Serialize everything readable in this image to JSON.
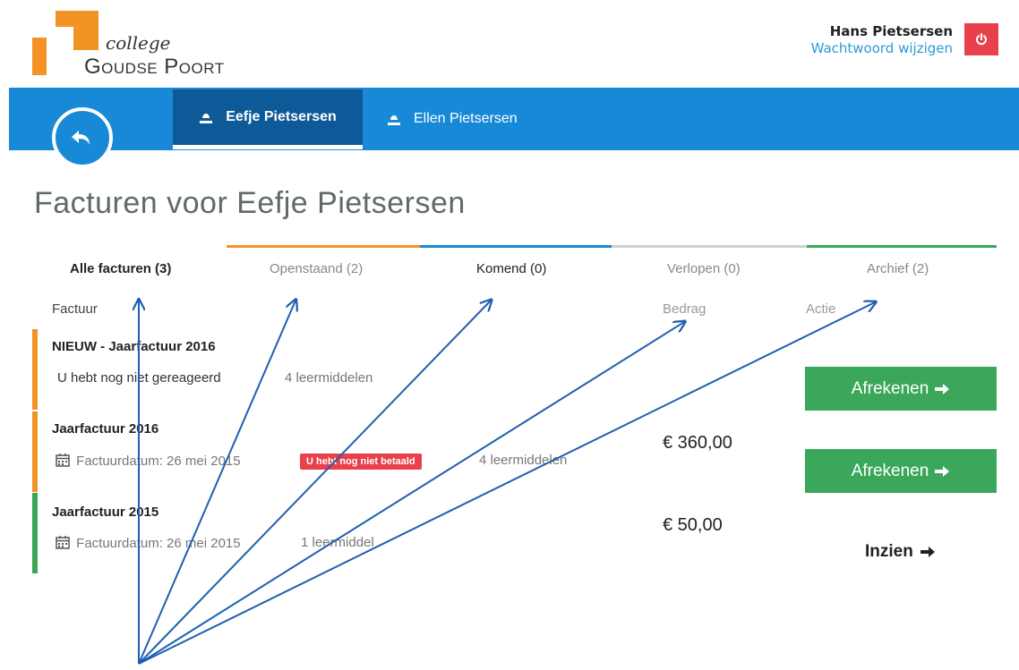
{
  "logo": {
    "line1": "college",
    "line2": "Goudse Poort"
  },
  "user": {
    "name": "Hans Pietsersen",
    "change_password": "Wachtwoord wijzigen"
  },
  "person_tabs": [
    {
      "label": "Eefje Pietsersen",
      "active": true
    },
    {
      "label": "Ellen Pietsersen",
      "active": false
    }
  ],
  "page_title": "Facturen voor Eefje Pietsersen",
  "status_tabs": [
    {
      "label": "Alle facturen (3)",
      "color": ""
    },
    {
      "label": "Openstaand (2)",
      "color": "#f39325"
    },
    {
      "label": "Komend (0)",
      "color": "#1889d6"
    },
    {
      "label": "Verlopen (0)",
      "color": "#cccccc"
    },
    {
      "label": "Archief (2)",
      "color": "#3aa75a"
    }
  ],
  "columns": {
    "invoice": "Factuur",
    "amount": "Bedrag",
    "action": "Actie"
  },
  "invoices": [
    {
      "new_tag": "NIEUW -",
      "title": "Jaarfactuur 2016",
      "status_text": "U hebt nog niet gereageerd",
      "items": "4 leermiddelen",
      "action": "Afrekenen",
      "bar_color": "#f39325"
    },
    {
      "title": "Jaarfactuur 2016",
      "date": "Factuurdatum: 26 mei 2015",
      "badge": "U hebt nog niet betaald",
      "items": "4 leermiddelen",
      "amount": "€ 360,00",
      "action": "Afrekenen",
      "bar_color": "#f39325"
    },
    {
      "title": "Jaarfactuur 2015",
      "date": "Factuurdatum: 26 mei 2015",
      "items": "1 leermiddel",
      "amount": "€ 50,00",
      "action": "Inzien",
      "bar_color": "#3aa75a"
    }
  ],
  "colors": {
    "blue": "#1889d6",
    "dark_blue": "#0e5a98",
    "orange": "#f39325",
    "green": "#3aa75a",
    "red": "#e8414c"
  }
}
